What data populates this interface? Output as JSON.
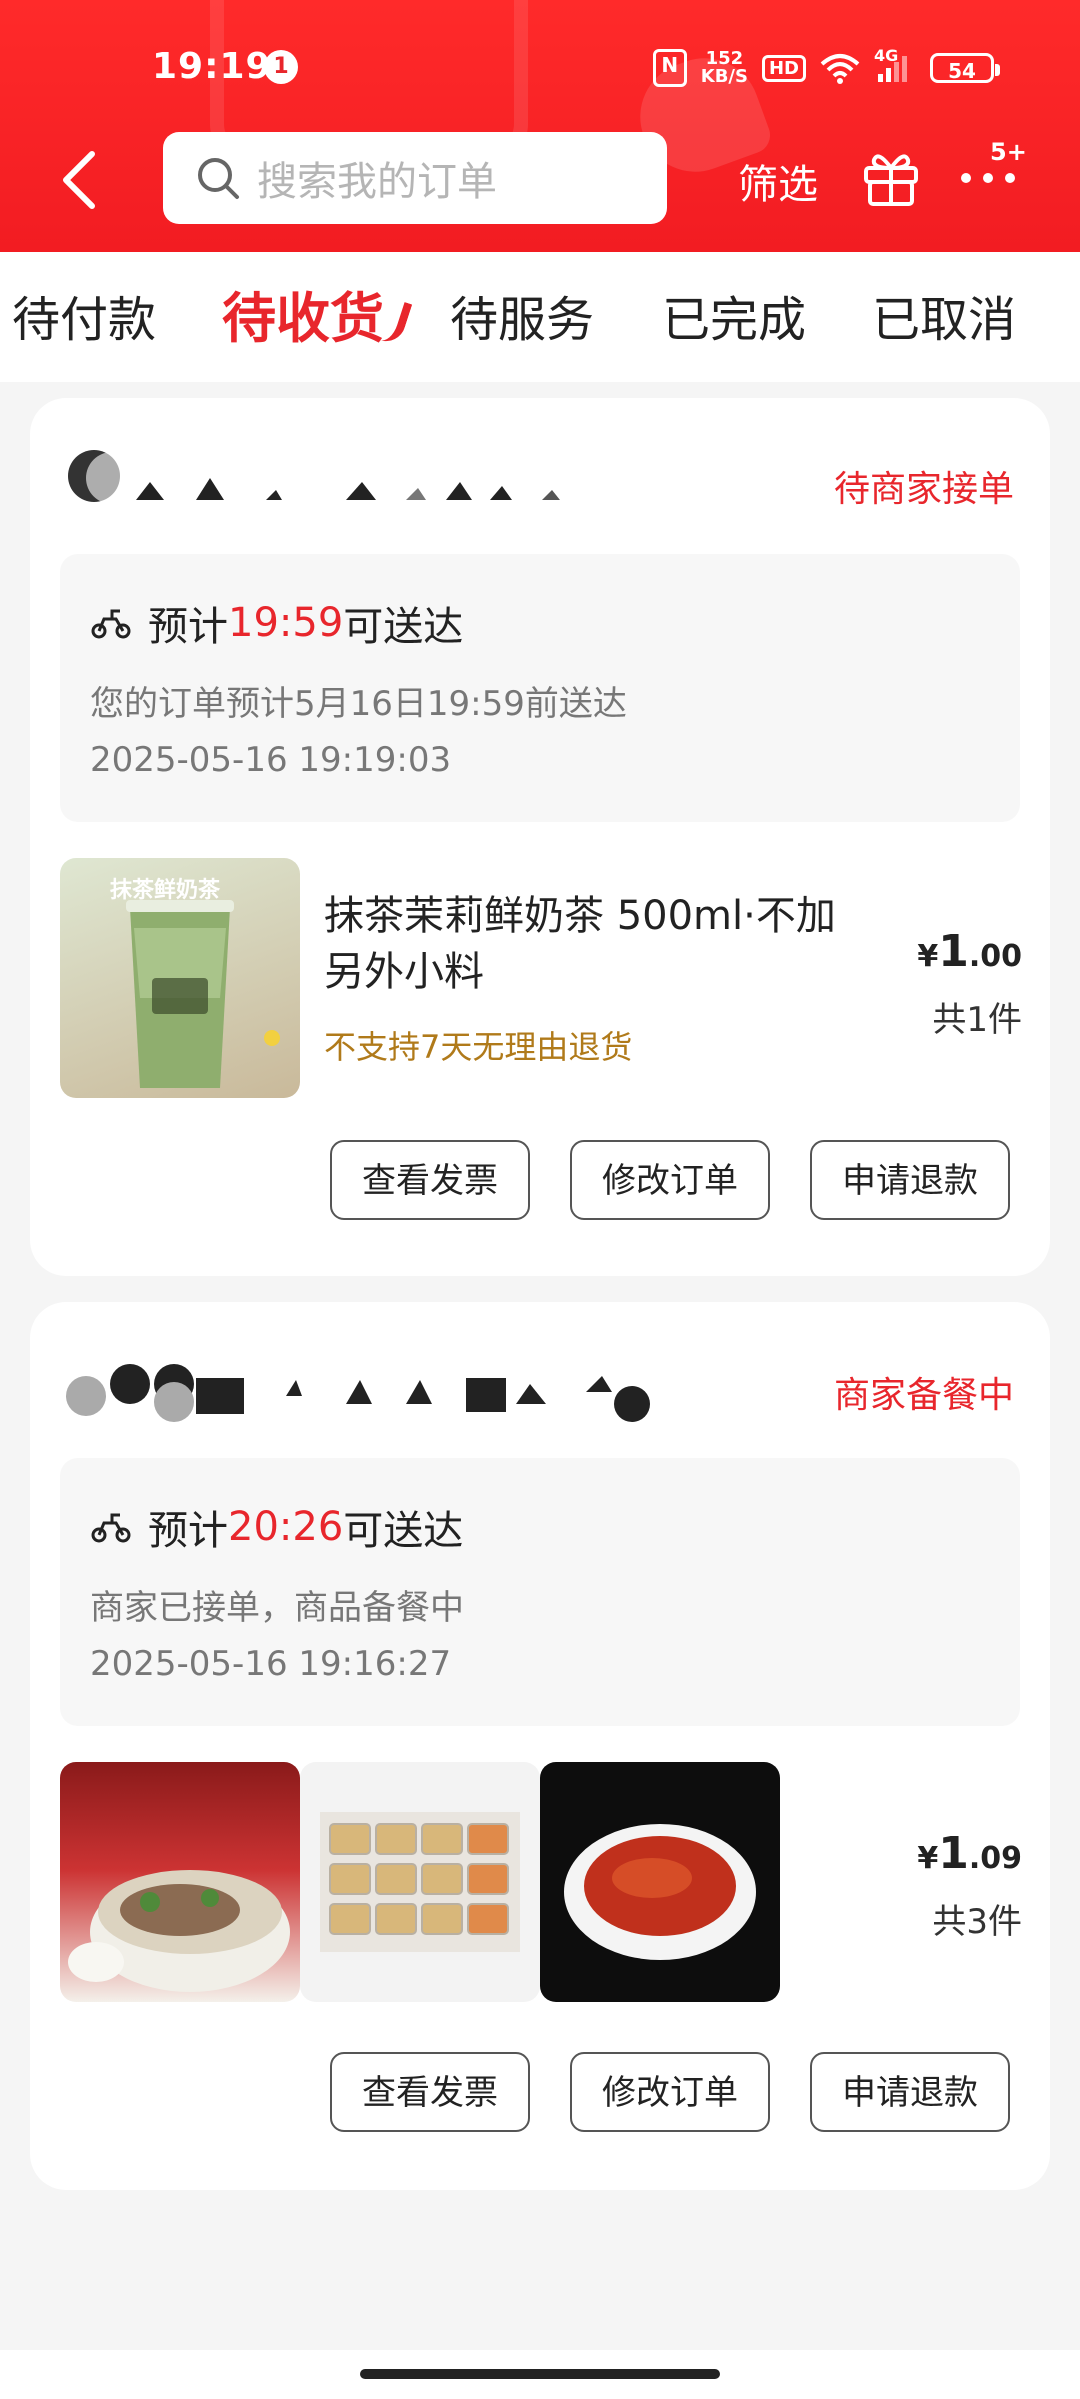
{
  "status_bar": {
    "time": "19:19",
    "notification_count": "1",
    "nfc": "N",
    "speed_value": "152",
    "speed_unit": "KB/S",
    "hd": "HD",
    "network": "4G",
    "battery": "54"
  },
  "header": {
    "search_placeholder": "搜索我的订单",
    "filter_label": "筛选",
    "more_badge": "5+"
  },
  "tabs": [
    {
      "label": "待付款",
      "active": false
    },
    {
      "label": "待收货",
      "active": true
    },
    {
      "label": "待服务",
      "active": false
    },
    {
      "label": "已完成",
      "active": false
    },
    {
      "label": "已取消",
      "active": false
    }
  ],
  "orders": [
    {
      "status": "待商家接单",
      "eta_prefix": "预计",
      "eta_time": "19:59",
      "eta_suffix": "可送达",
      "description": "您的订单预计5月16日19:59前送达",
      "timestamp": "2025-05-16 19:19:03",
      "product_name": "抹茶茉莉鲜奶茶 500ml·不加另外小料",
      "product_note": "不支持7天无理由退货",
      "thumb_label": "抹茶鲜奶茶",
      "price_symbol": "¥",
      "price_int": "1",
      "price_dec": ".00",
      "count": "共1件",
      "buttons": [
        "查看发票",
        "修改订单",
        "申请退款"
      ]
    },
    {
      "status": "商家备餐中",
      "eta_prefix": "预计",
      "eta_time": "20:26",
      "eta_suffix": "可送达",
      "description": "商家已接单，商品备餐中",
      "timestamp": "2025-05-16 19:16:27",
      "price_symbol": "¥",
      "price_int": "1",
      "price_dec": ".09",
      "count": "共3件",
      "buttons": [
        "查看发票",
        "修改订单",
        "申请退款"
      ]
    }
  ],
  "colors": {
    "brand_red": "#e8262c",
    "note_brown": "#b07a1a"
  }
}
